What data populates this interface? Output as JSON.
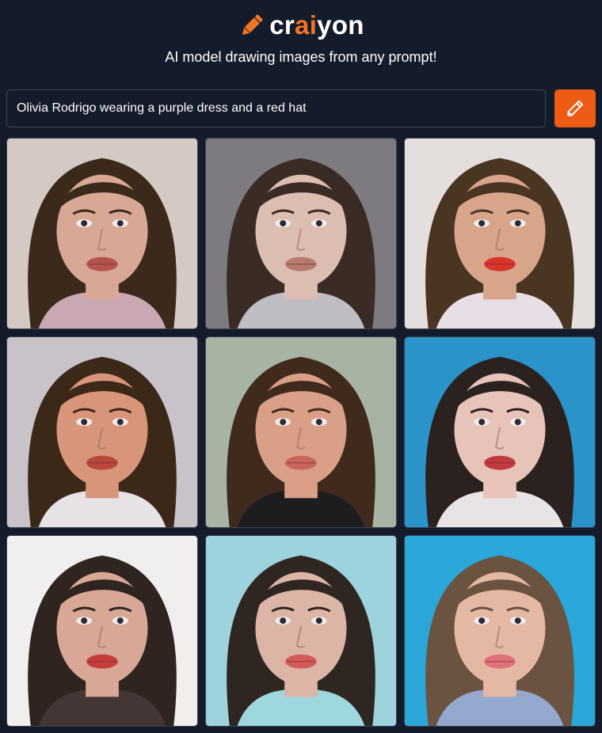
{
  "header": {
    "logo_prefix": "cr",
    "logo_accent": "ai",
    "logo_suffix": "yon",
    "logo_icon": "pencil-icon",
    "tagline": "AI model drawing images from any prompt!"
  },
  "prompt": {
    "value": "Olivia Rodrigo wearing a purple dress and a red hat",
    "button_icon": "pencil-icon"
  },
  "colors": {
    "background": "#141b2b",
    "accent": "#f27623",
    "button": "#ee5b14"
  },
  "results": {
    "images": [
      {
        "name": "generated-image-1",
        "bg": "#d6c9c4",
        "hair": "#3b2a1c",
        "skin": "#d9a895",
        "shirt": "#c9a8b3",
        "lip": "#b5544e"
      },
      {
        "name": "generated-image-2",
        "bg": "#7d7b80",
        "hair": "#3a2b24",
        "skin": "#dcbdb1",
        "shirt": "#bfbcc3",
        "lip": "#b67a6f"
      },
      {
        "name": "generated-image-3",
        "bg": "#e4dedc",
        "hair": "#4a3422",
        "skin": "#d8a58a",
        "shirt": "#e8dfe6",
        "lip": "#d9342c"
      },
      {
        "name": "generated-image-4",
        "bg": "#c7c3c9",
        "hair": "#3c2818",
        "skin": "#d9957a",
        "shirt": "#e6e2e6",
        "lip": "#b8473c"
      },
      {
        "name": "generated-image-5",
        "bg": "#a8b4a3",
        "hair": "#3f2a1d",
        "skin": "#d9a087",
        "shirt": "#1d1d1f",
        "lip": "#c9655a"
      },
      {
        "name": "generated-image-6",
        "bg": "#2a93c9",
        "hair": "#2b2220",
        "skin": "#e7c3b9",
        "shirt": "#e8e3e4",
        "lip": "#c23a3e"
      },
      {
        "name": "generated-image-7",
        "bg": "#f1efee",
        "hair": "#2f2420",
        "skin": "#d9a795",
        "shirt": "#433634",
        "lip": "#c53d3b"
      },
      {
        "name": "generated-image-8",
        "bg": "#9cd3dc",
        "hair": "#2f2622",
        "skin": "#ddb5a7",
        "shirt": "#9fd7de",
        "lip": "#d45a58"
      },
      {
        "name": "generated-image-9",
        "bg": "#2aa6d8",
        "hair": "#6a5340",
        "skin": "#e5b8a3",
        "shirt": "#95a8d0",
        "lip": "#e0707a"
      }
    ]
  }
}
